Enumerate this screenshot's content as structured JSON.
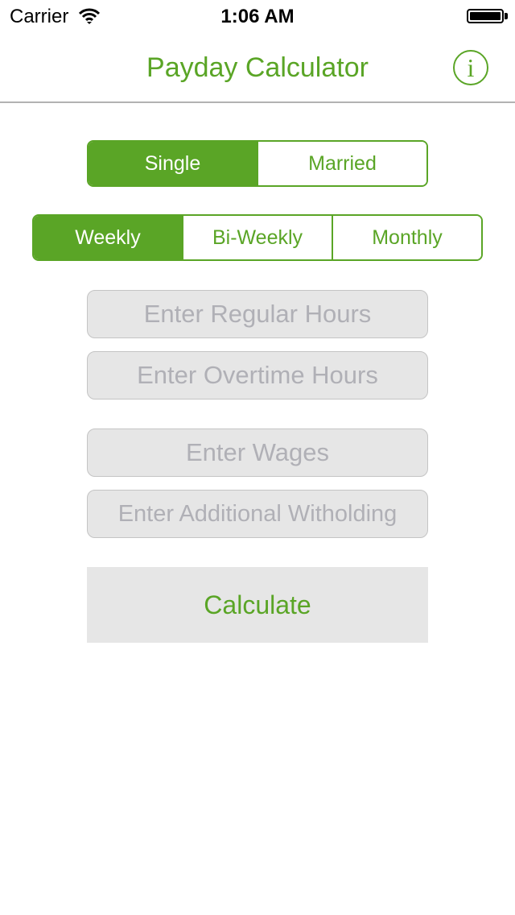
{
  "status_bar": {
    "carrier": "Carrier",
    "time": "1:06 AM",
    "wifi_icon": "wifi-icon",
    "battery_icon": "battery-icon",
    "battery_level": 1.0
  },
  "nav": {
    "title": "Payday Calculator",
    "info_icon_glyph": "i",
    "info_icon": "info-icon"
  },
  "filing_status": {
    "options": [
      "Single",
      "Married"
    ],
    "selected": "Single"
  },
  "pay_period": {
    "options": [
      "Weekly",
      "Bi-Weekly",
      "Monthly"
    ],
    "selected": "Weekly"
  },
  "fields": {
    "regular_hours": {
      "value": "",
      "placeholder": "Enter Regular Hours"
    },
    "overtime_hours": {
      "value": "",
      "placeholder": "Enter Overtime Hours"
    },
    "wages": {
      "value": "",
      "placeholder": "Enter Wages"
    },
    "additional_withholding": {
      "value": "",
      "placeholder": "Enter Additional Witholding"
    }
  },
  "actions": {
    "calculate_label": "Calculate"
  },
  "colors": {
    "accent": "#5aa526",
    "field_background": "#e6e6e6",
    "placeholder": "#b0b0b6",
    "divider": "#b2b2b2"
  }
}
